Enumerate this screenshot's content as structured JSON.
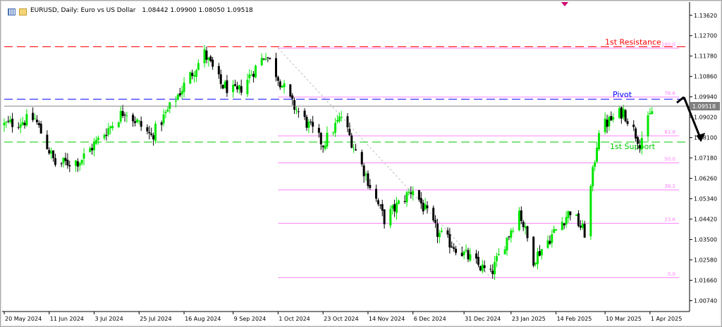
{
  "header": {
    "symbol_line": "EURUSD, Daily:  Euro vs US Dollar",
    "ohlc": "1.08442 1.09900 1.08050 1.09518",
    "icons": [
      "bar-chart-icon",
      "settings-icon"
    ]
  },
  "colors": {
    "bull": "#00e600",
    "bear": "#000000",
    "resistance": "#ff0000",
    "pivot": "#0000ff",
    "support": "#00c800",
    "fib": "#ff80ff",
    "price_line": "#808080",
    "price_box": "#808080",
    "arrow": "#000000"
  },
  "chart_data": {
    "type": "candlestick",
    "symbol": "EURUSD",
    "timeframe": "Daily",
    "ylim": [
      1.0025,
      1.1412
    ],
    "xlim": [
      "2024-05-20",
      "2025-04-10"
    ],
    "y_ticks": [
      "1.13620",
      "1.12700",
      "1.11780",
      "1.10860",
      "1.09940",
      "1.09020",
      "1.08100",
      "1.07180",
      "1.06260",
      "1.05340",
      "1.04420",
      "1.03500",
      "1.02580",
      "1.01660",
      "1.00740"
    ],
    "x_ticks": [
      "20 May 2024",
      "11 Jun 2024",
      "3 Jul 2024",
      "25 Jul 2024",
      "16 Aug 2024",
      "9 Sep 2024",
      "1 Oct 2024",
      "23 Oct 2024",
      "14 Nov 2024",
      "6 Dec 2024",
      "31 Dec 2024",
      "23 Jan 2025",
      "14 Feb 2025",
      "10 Mar 2025",
      "1 Apr 2025"
    ],
    "current_price": "1.09518",
    "price_path": [
      {
        "d": "2024-05-20",
        "p": 1.0868
      },
      {
        "d": "2024-06-04",
        "p": 1.0895
      },
      {
        "d": "2024-06-14",
        "p": 1.069
      },
      {
        "d": "2024-06-26",
        "p": 1.0705
      },
      {
        "d": "2024-07-18",
        "p": 1.0935
      },
      {
        "d": "2024-07-31",
        "p": 1.0815
      },
      {
        "d": "2024-08-26",
        "p": 1.119
      },
      {
        "d": "2024-09-03",
        "p": 1.105
      },
      {
        "d": "2024-09-11",
        "p": 1.101
      },
      {
        "d": "2024-09-25",
        "p": 1.119
      },
      {
        "d": "2024-10-08",
        "p": 1.096
      },
      {
        "d": "2024-10-23",
        "p": 1.078
      },
      {
        "d": "2024-11-01",
        "p": 1.0905
      },
      {
        "d": "2024-11-22",
        "p": 1.044
      },
      {
        "d": "2024-12-06",
        "p": 1.058
      },
      {
        "d": "2024-12-18",
        "p": 1.038
      },
      {
        "d": "2025-01-13",
        "p": 1.019
      },
      {
        "d": "2025-01-27",
        "p": 1.048
      },
      {
        "d": "2025-02-03",
        "p": 1.026
      },
      {
        "d": "2025-02-21",
        "p": 1.048
      },
      {
        "d": "2025-02-28",
        "p": 1.038
      },
      {
        "d": "2025-03-07",
        "p": 1.085
      },
      {
        "d": "2025-03-19",
        "p": 1.093
      },
      {
        "d": "2025-03-27",
        "p": 1.079
      },
      {
        "d": "2025-04-03",
        "p": 1.0952
      }
    ],
    "levels": [
      {
        "label": "1st Resistance",
        "value": 1.122,
        "color": "#ff0000",
        "style": "dashed"
      },
      {
        "label": "Pivot",
        "value": 1.0983,
        "color": "#0000ff",
        "style": "dashed"
      },
      {
        "label": "1st Support",
        "value": 1.079,
        "color": "#00c800",
        "style": "dashed"
      }
    ],
    "fibonacci": {
      "start": "2024-10-01",
      "end": "2025-01-13",
      "high": 1.1214,
      "low": 1.0178,
      "levels": [
        {
          "label": "100.0",
          "value": 1.1214
        },
        {
          "label": "78.6",
          "value": 1.0993
        },
        {
          "label": "61.8",
          "value": 1.0818
        },
        {
          "label": "50.0",
          "value": 1.0696
        },
        {
          "label": "38.2",
          "value": 1.0574
        },
        {
          "label": "23.6",
          "value": 1.0423
        },
        {
          "label": "0.0",
          "value": 1.0178
        }
      ]
    },
    "arrow": {
      "from": {
        "d": "2025-04-10",
        "p": 1.0993
      },
      "to": {
        "d": "2025-04-17",
        "p": 1.08
      }
    }
  }
}
